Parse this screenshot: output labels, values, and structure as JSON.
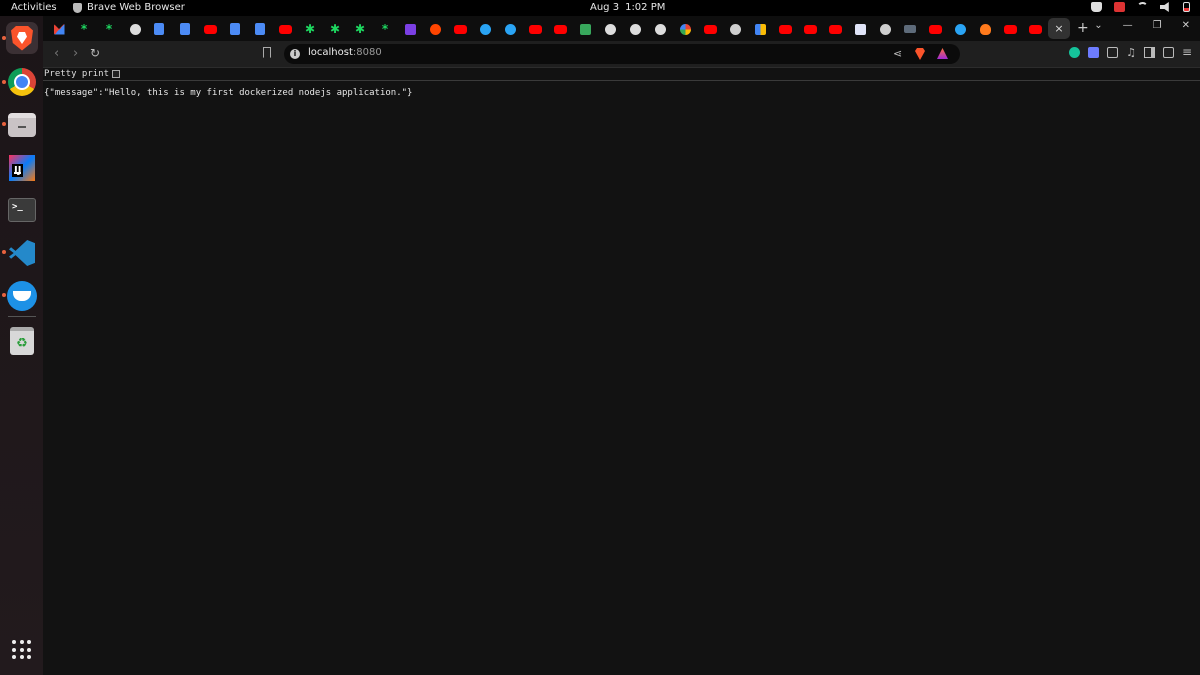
{
  "topbar": {
    "activities": "Activities",
    "app_name": "Brave Web Browser",
    "date": "Aug 3",
    "time": "1:02 PM"
  },
  "dock": {
    "apps": [
      "brave-browser",
      "google-chrome",
      "files",
      "intellij-idea",
      "terminal",
      "visual-studio-code",
      "docker-desktop",
      "trash"
    ]
  },
  "browser": {
    "tabs": [
      "gmail",
      "spark",
      "spark",
      "github",
      "docs",
      "docs",
      "youtube",
      "docs",
      "youtube",
      "spark",
      "spark",
      "spark",
      "spark",
      "youtube",
      "reddit",
      "youtube",
      "web",
      "web",
      "youtube",
      "youtube",
      "spark",
      "github",
      "github",
      "github",
      "google",
      "youtube",
      "web",
      "multi",
      "youtube",
      "youtube",
      "youtube",
      "x",
      "web",
      "dim",
      "youtube",
      "web",
      "fire",
      "youtube",
      "youtube"
    ],
    "active_tab_close": "×",
    "new_tab": "+",
    "url_host": "localhost",
    "url_port": ":8080"
  },
  "page": {
    "pretty_print_label": "Pretty print",
    "pretty_print_checked": false,
    "json_text": "{\"message\":\"Hello, this is my first dockerized nodejs application.\"}"
  }
}
